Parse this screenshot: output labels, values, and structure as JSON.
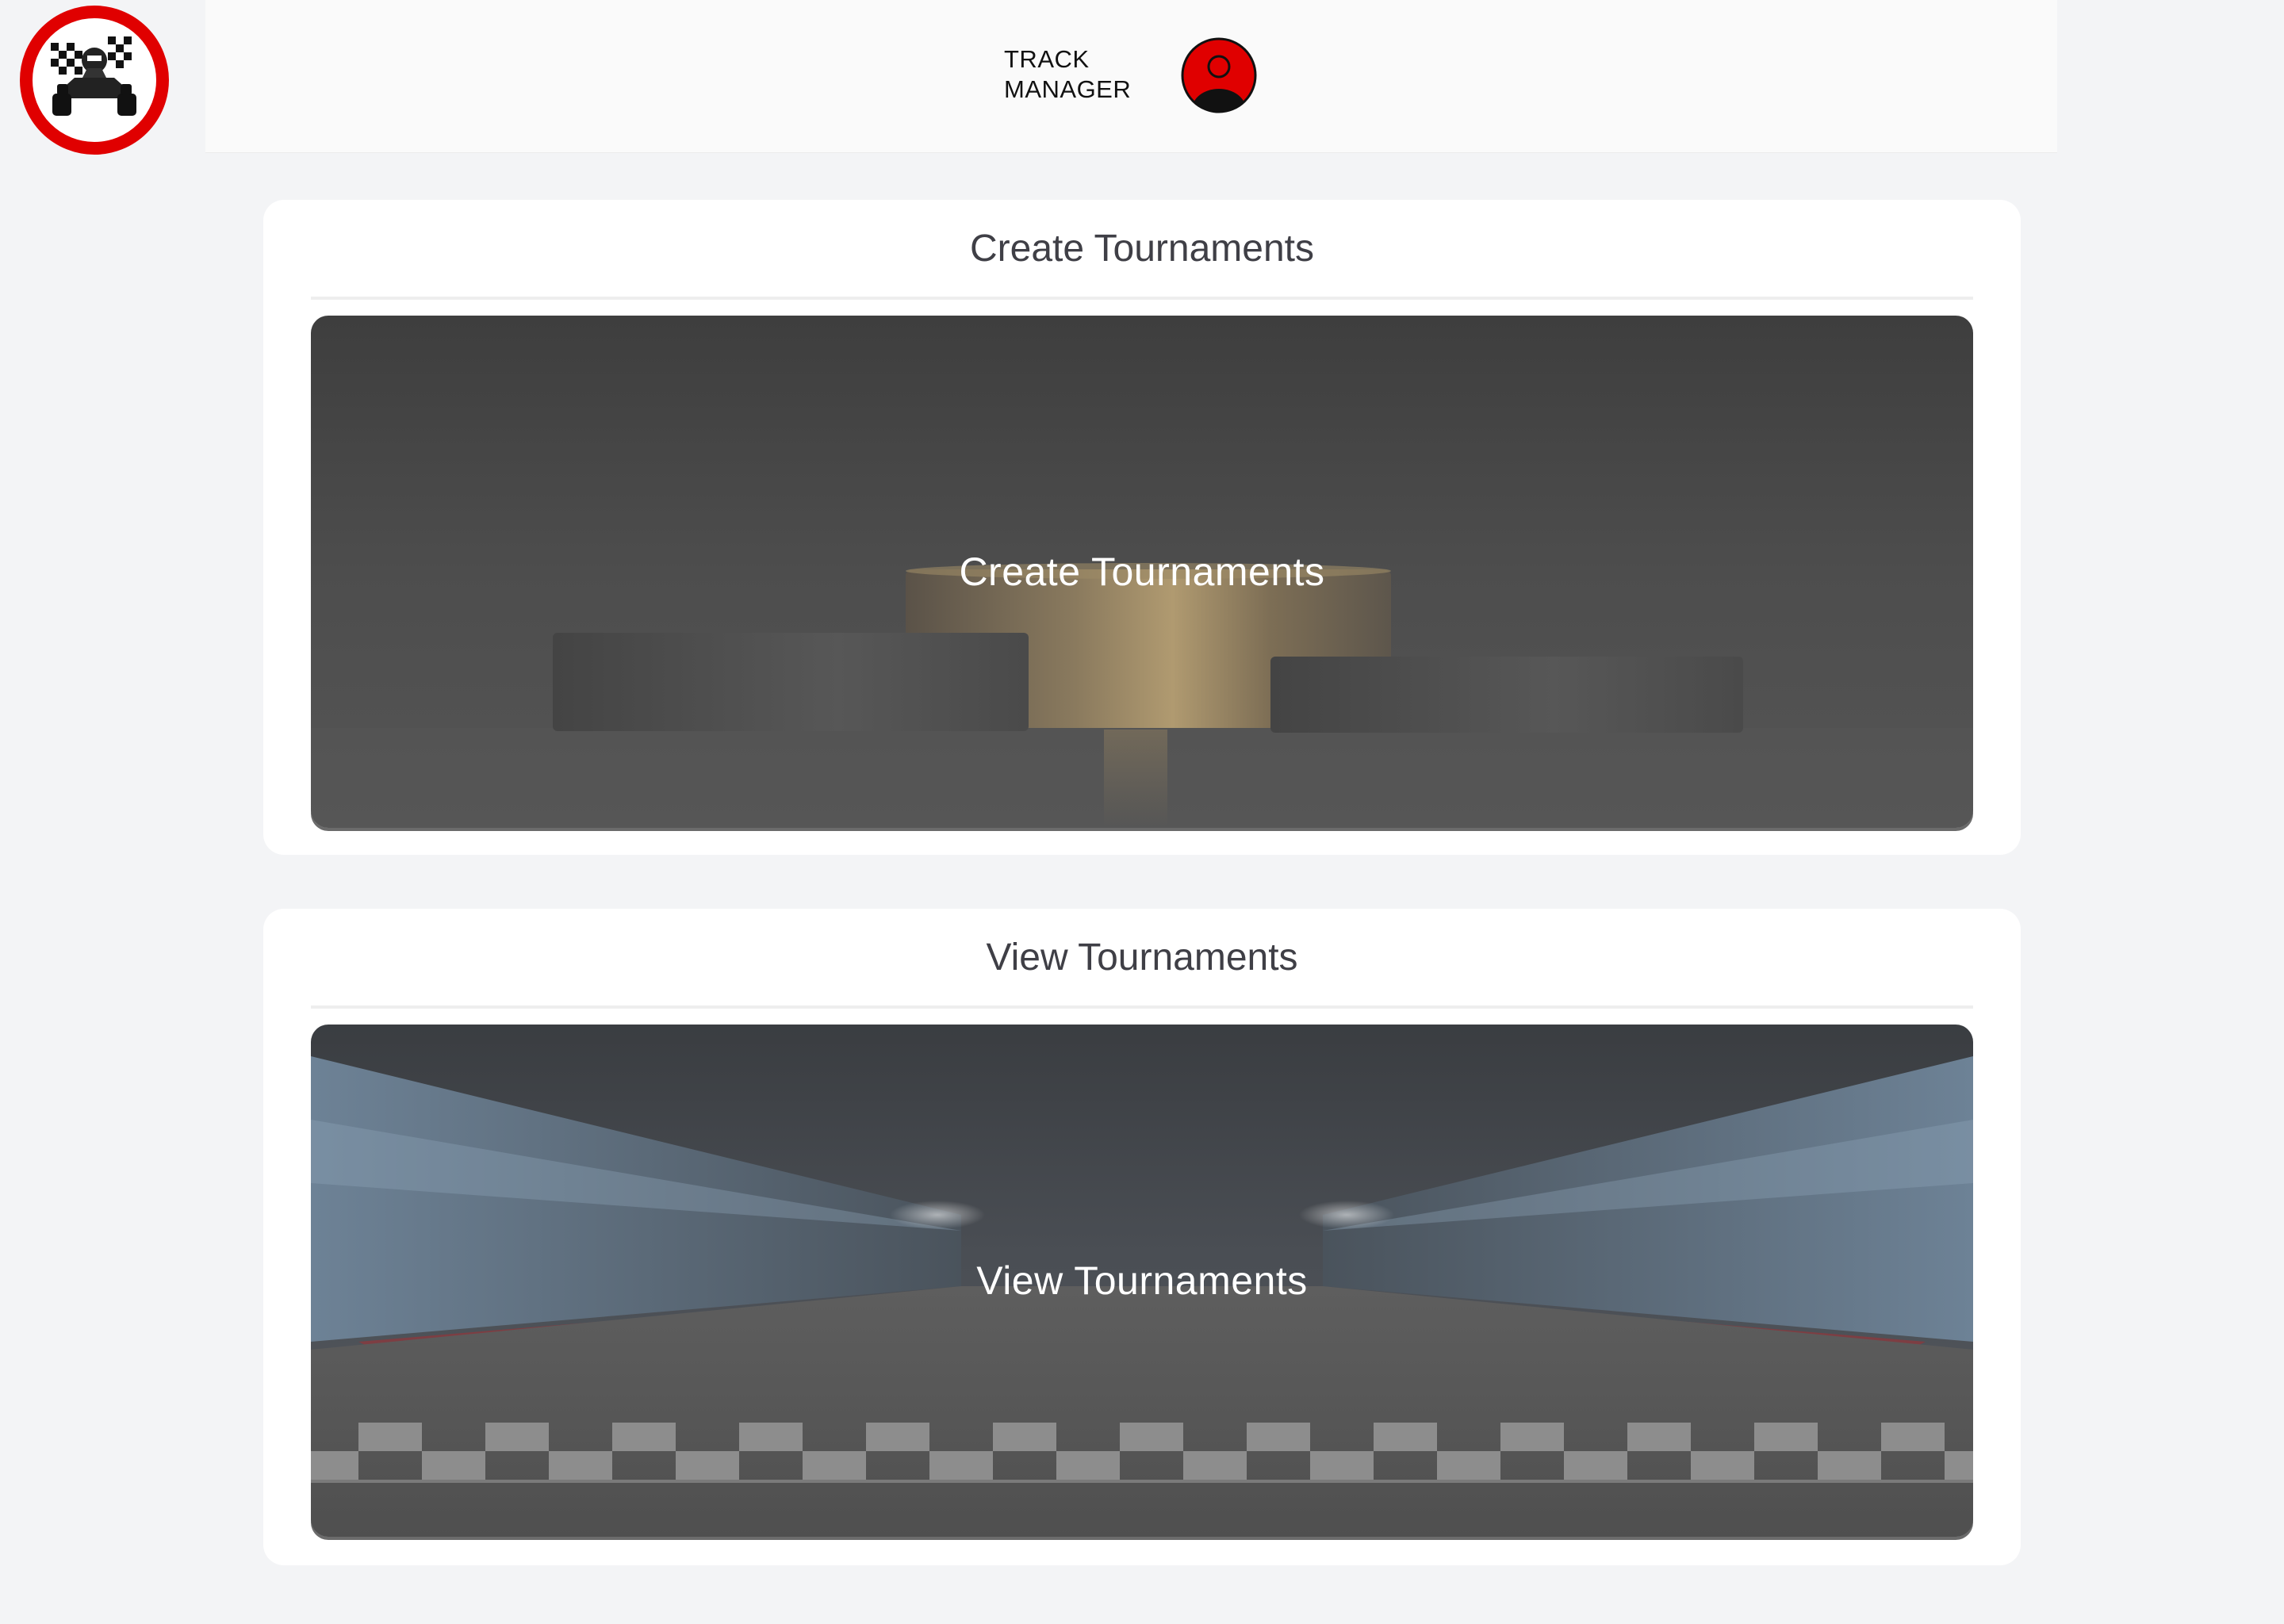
{
  "brand": {
    "line1": "TRACK",
    "line2": "MANAGER",
    "logo_icon": "go-kart-checkered-flag-icon",
    "logo_ring_color": "#e00000"
  },
  "header": {
    "avatar_icon": "user-avatar-icon",
    "avatar_color": "#e00000"
  },
  "cards": {
    "create": {
      "title": "Create Tournaments",
      "banner_label": "Create Tournaments",
      "banner_image": "podium-image"
    },
    "view": {
      "title": "View Tournaments",
      "banner_label": "View Tournaments",
      "banner_image": "race-track-image"
    }
  }
}
